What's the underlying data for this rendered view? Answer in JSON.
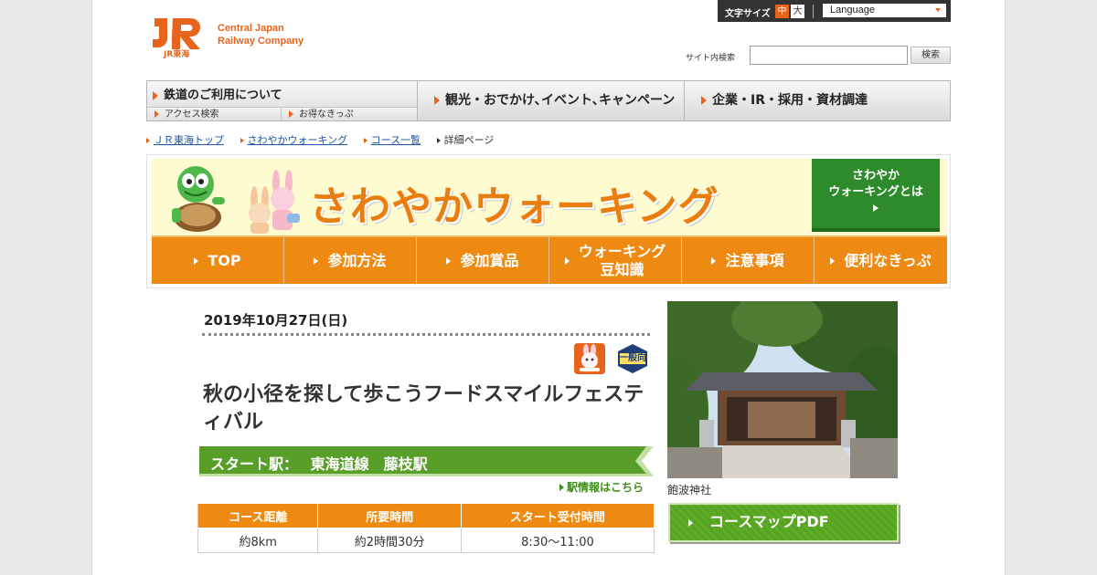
{
  "header": {
    "logo_text_line1": "Central Japan",
    "logo_text_line2": "Railway Company",
    "logo_sub": "JR東海",
    "font_size_label": "文字サイズ",
    "font_size_mid": "中",
    "font_size_large": "大",
    "language_label": "Language",
    "search_label": "サイト内検索",
    "search_button": "検索"
  },
  "gnav": {
    "item1": "鉄道のご利用について",
    "item1_sub1": "アクセス検索",
    "item1_sub2": "お得なきっぷ",
    "item2": "観光・おでかけ､イベント､キャンペーン",
    "item3": "企業・IR・採用・資材調達"
  },
  "breadcrumb": {
    "c1": "ＪＲ東海トップ",
    "c2": "さわやかウォーキング",
    "c3": "コース一覧",
    "c4": "詳細ページ"
  },
  "banner": {
    "title": "さわやかウォーキング",
    "about_line1": "さわやか",
    "about_line2": "ウォーキングとは",
    "nav": [
      {
        "label": "TOP"
      },
      {
        "label": "参加方法"
      },
      {
        "label": "参加賞品"
      },
      {
        "label": "ウォーキング\n豆知識"
      },
      {
        "label": "注意事項"
      },
      {
        "label": "便利なきっぷ"
      }
    ]
  },
  "course": {
    "date": "2019年10月27日(日)",
    "icon_general": "一般向",
    "title": "秋の小径を探して歩こうフードスマイルフェスティバル",
    "start_label": "スタート駅：",
    "start_station": "東海道線　藤枝駅",
    "station_link": "駅情報はこちら",
    "table_headers": [
      "コース距離",
      "所要時間",
      "スタート受付時間"
    ],
    "table_values": [
      "約8km",
      "約2時間30分",
      "8:30～11:00"
    ],
    "photo_caption": "飽波神社",
    "pdf_button": "コースマップPDF"
  },
  "colors": {
    "brand_orange": "#e8641c",
    "nav_orange": "#ee8a12",
    "walking_green": "#55a51e",
    "about_green": "#2e8b2b",
    "link_blue": "#1a55a8"
  }
}
